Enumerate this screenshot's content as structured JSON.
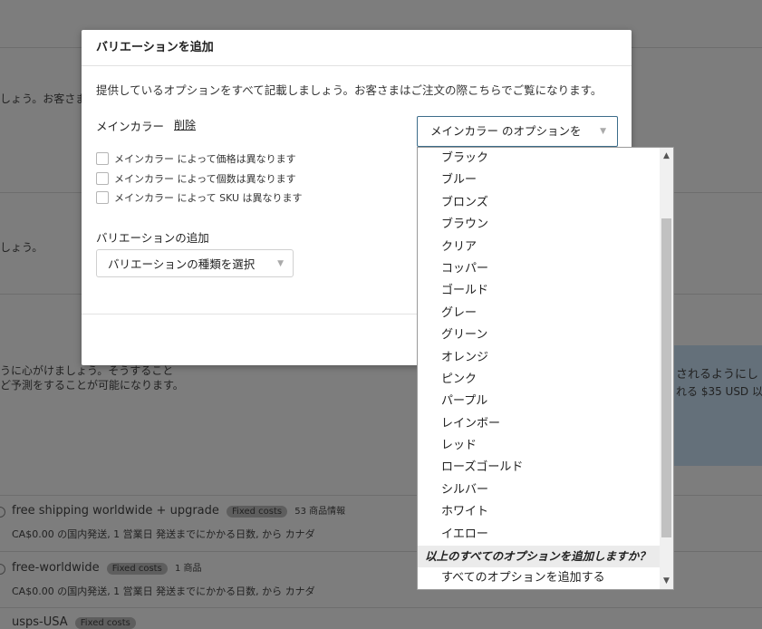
{
  "background": {
    "frag1": "しょう。お客さま",
    "frag2": "しょう。",
    "frag3": "うに心がけましょう。そうすること",
    "frag4": "ど予測をすることが可能になります。",
    "frag5": "されるようにし",
    "frag6": "れる $35 USD 以上",
    "profiles": [
      {
        "name": "free shipping worldwide + upgrade",
        "badge": "Fixed costs",
        "count": "53 商品情報",
        "detail": "CA$0.00 の国内発送, 1 営業日 発送までにかかる日数, から カナダ"
      },
      {
        "name": "free-worldwide",
        "badge": "Fixed costs",
        "count": "1 商品",
        "detail": "CA$0.00 の国内発送, 1 営業日 発送までにかかる日数, から カナダ"
      },
      {
        "name": "usps-USA",
        "badge": "Fixed costs",
        "count": "",
        "detail": ""
      }
    ]
  },
  "modal": {
    "title": "バリエーションを追加",
    "description": "提供しているオプションをすべて記載しましょう。お客さまはご注文の際こちらでご覧になります。",
    "variation_name": "メインカラー",
    "delete_label": "削除",
    "checkboxes": [
      "メインカラー によって価格は異なります",
      "メインカラー によって個数は異なります",
      "メインカラー によって SKU は異なります"
    ],
    "add_variation_label": "バリエーションの追加",
    "variation_type_select": "バリエーションの種類を選択",
    "options_select": "メインカラー のオプションを"
  },
  "dropdown": {
    "options": [
      "ブラック",
      "ブルー",
      "ブロンズ",
      "ブラウン",
      "クリア",
      "コッパー",
      "ゴールド",
      "グレー",
      "グリーン",
      "オレンジ",
      "ピンク",
      "パープル",
      "レインボー",
      "レッド",
      "ローズゴールド",
      "シルバー",
      "ホワイト",
      "イエロー"
    ],
    "group_label": "以上のすべてのオプションを追加しますか？",
    "add_all": "すべてのオプションを追加する"
  }
}
